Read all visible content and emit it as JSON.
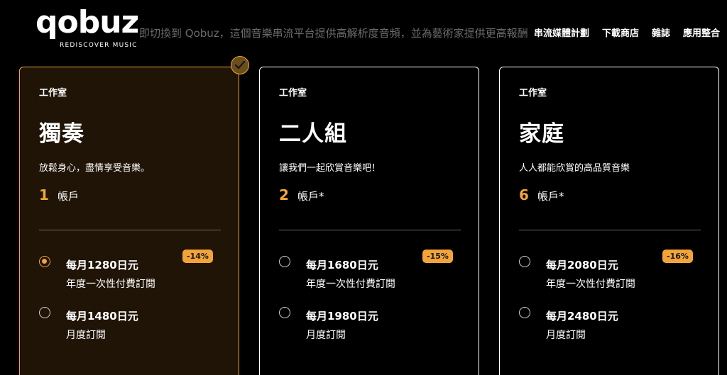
{
  "header": {
    "logo_word": "qobuz",
    "logo_tagline": "REDISCOVER MUSIC",
    "marquee_text": "即切換到 Qobuz，這個音樂串流平台提供高解析度音頻，並為藝術家提供更高報酬",
    "nav": [
      "串流媒體計劃",
      "下載商店",
      "雜誌",
      "應用整合"
    ]
  },
  "colors": {
    "accent": "#f2a43a",
    "selected_bg": "#201406"
  },
  "icons": {
    "selected_check": "check-icon"
  },
  "plans": [
    {
      "studio": "工作室",
      "name": "獨奏",
      "tagline": "放鬆身心，盡情享受音樂。",
      "account_count": "1",
      "account_label": "帳戶",
      "options": [
        {
          "price": "每月1280日元",
          "billing": "年度一次性付費訂閱",
          "discount": "-14%",
          "selected": true
        },
        {
          "price": "每月1480日元",
          "billing": "月度訂閱",
          "selected": false
        }
      ]
    },
    {
      "studio": "工作室",
      "name": "二人組",
      "tagline": "讓我們一起欣賞音樂吧！",
      "account_count": "2",
      "account_label": "帳戶*",
      "options": [
        {
          "price": "每月1680日元",
          "billing": "年度一次性付費訂閱",
          "discount": "-15%",
          "selected": false
        },
        {
          "price": "每月1980日元",
          "billing": "月度訂閱",
          "selected": false
        }
      ]
    },
    {
      "studio": "工作室",
      "name": "家庭",
      "tagline": "人人都能欣賞的高品質音樂",
      "account_count": "6",
      "account_label": "帳戶*",
      "options": [
        {
          "price": "每月2080日元",
          "billing": "年度一次性付費訂閱",
          "discount": "-16%",
          "selected": false
        },
        {
          "price": "每月2480日元",
          "billing": "月度訂閱",
          "selected": false
        }
      ]
    }
  ]
}
